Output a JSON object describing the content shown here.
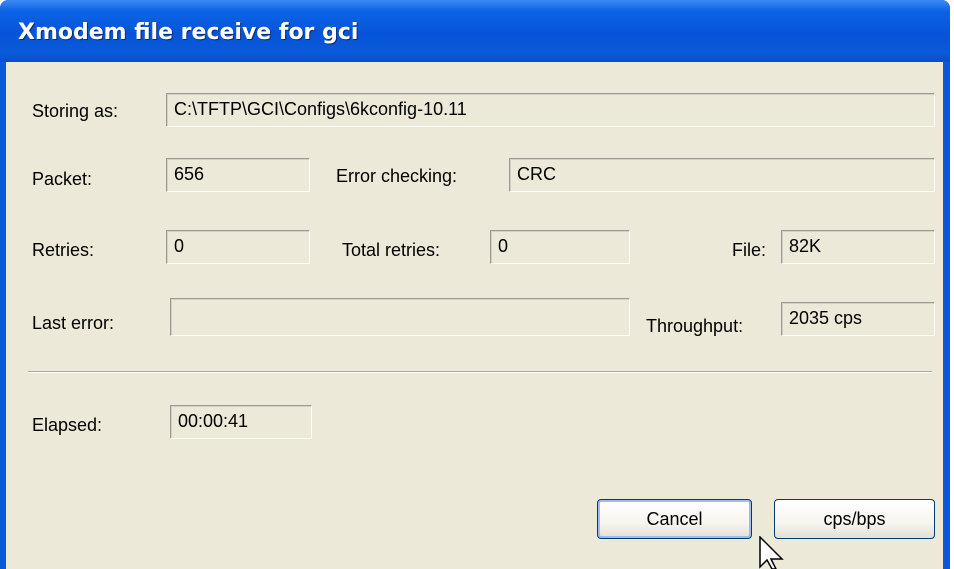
{
  "window": {
    "title": "Xmodem file receive for gci"
  },
  "fields": {
    "storing_as": {
      "label": "Storing as:",
      "value": "C:\\TFTP\\GCI\\Configs\\6kconfig-10.11"
    },
    "packet": {
      "label": "Packet:",
      "value": "656"
    },
    "error_checking": {
      "label": "Error checking:",
      "value": "CRC"
    },
    "retries": {
      "label": "Retries:",
      "value": "0"
    },
    "total_retries": {
      "label": "Total retries:",
      "value": "0"
    },
    "file": {
      "label": "File:",
      "value": "82K"
    },
    "last_error": {
      "label": "Last error:",
      "value": ""
    },
    "throughput": {
      "label": "Throughput:",
      "value": "2035 cps"
    },
    "elapsed": {
      "label": "Elapsed:",
      "value": "00:00:41"
    }
  },
  "buttons": {
    "cancel": "Cancel",
    "cps_bps": "cps/bps"
  },
  "icons": {
    "cursor": "mouse-pointer-icon"
  },
  "colors": {
    "titlebar": "#0a59dc",
    "client": "#ece9d8",
    "title_text": "#ffffff"
  }
}
